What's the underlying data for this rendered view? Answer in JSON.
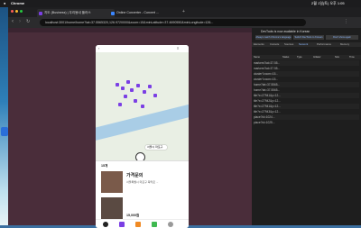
{
  "menubar": {
    "app": "Chrome",
    "clock": "2월 1일(토) 오후 1:05"
  },
  "tabs": [
    {
      "label": "지도 (Business) | 우리동네 플러스",
      "active": true
    },
    {
      "label": "Online Converter - Convert ...",
      "active": false
    }
  ],
  "url": "localhost:3001/home/home?lat=37.5565320,126.9720000&zoom=15&minLatitude=37.4690550&minLongitude=126...",
  "phone": {
    "badge": "서울시 마포구",
    "sheet_title": "15개",
    "card_title": "가격문의",
    "card_sub": "서울특별시 마포구 독막로 ...",
    "price": "15,000원"
  },
  "devtools": {
    "banner": "DevTools is now available in Korean",
    "btn1": "Always match Chrome's language",
    "btn2": "Switch DevTools to Korean",
    "btn3": "Don't show again",
    "tabs": [
      "Elements",
      "Console",
      "Sources",
      "Network",
      "Performance",
      "Memory"
    ],
    "columns": [
      "Name",
      "Status",
      "Type",
      "Initiator",
      "Size",
      "Time"
    ],
    "rows": [
      "markers?lat=37.55...",
      "markers?lat=37.55...",
      "cluster?zoom=15...",
      "cluster?zoom=15...",
      "home?lat=37.5565...",
      "home?lat=37.5565...",
      "tile?x=27941&y=12...",
      "tile?x=27942&y=12...",
      "tile?x=27941&y=12...",
      "tile?x=27943&y=12...",
      "place?id=1024...",
      "place?id=1025..."
    ]
  },
  "colors": {
    "accent": "#7b3fe4",
    "content_bg": "#4a2d3a",
    "devtools_bg": "#1e1e1e"
  }
}
